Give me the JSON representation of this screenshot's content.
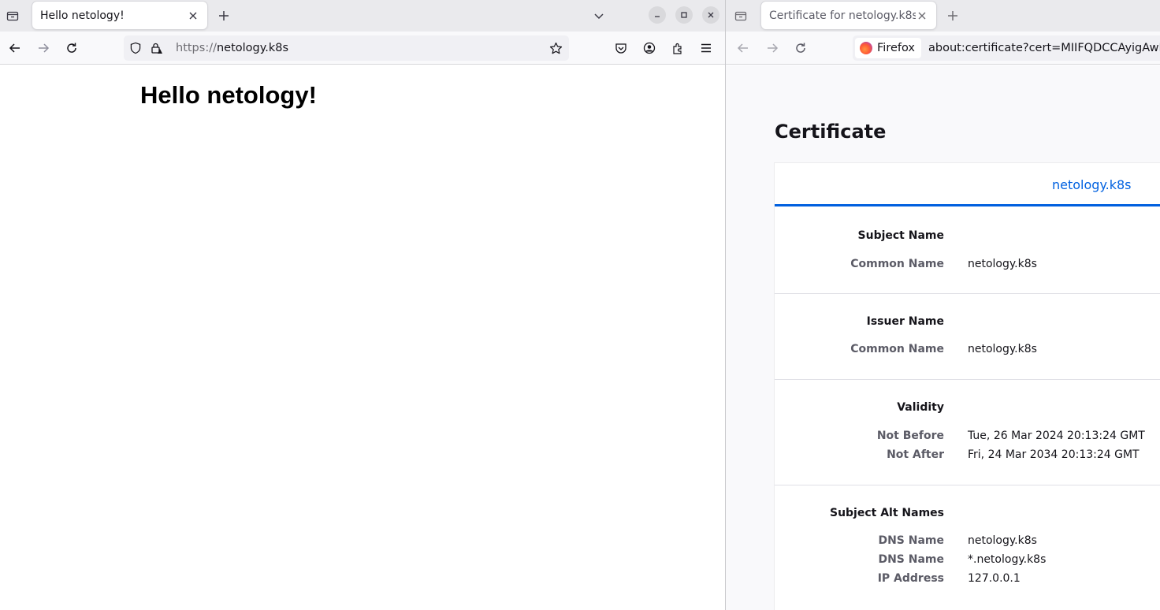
{
  "left_window": {
    "tab_title": "Hello netology!",
    "url_scheme": "https://",
    "url_host": "netology.k8s",
    "page_heading": "Hello netology!"
  },
  "right_window": {
    "tab_title": "Certificate for netology.k8s",
    "identity_label": "Firefox",
    "url": "about:certificate?cert=MIIFQDCCAyigAwIB",
    "page_title": "Certificate",
    "cert_tab": "netology.k8s",
    "sections": {
      "subject": {
        "title": "Subject Name",
        "rows": [
          {
            "label": "Common Name",
            "value": "netology.k8s"
          }
        ]
      },
      "issuer": {
        "title": "Issuer Name",
        "rows": [
          {
            "label": "Common Name",
            "value": "netology.k8s"
          }
        ]
      },
      "validity": {
        "title": "Validity",
        "rows": [
          {
            "label": "Not Before",
            "value": "Tue, 26 Mar 2024 20:13:24 GMT"
          },
          {
            "label": "Not After",
            "value": "Fri, 24 Mar 2034 20:13:24 GMT"
          }
        ]
      },
      "san": {
        "title": "Subject Alt Names",
        "rows": [
          {
            "label": "DNS Name",
            "value": "netology.k8s"
          },
          {
            "label": "DNS Name",
            "value": "*.netology.k8s"
          },
          {
            "label": "IP Address",
            "value": "127.0.0.1"
          }
        ]
      }
    }
  },
  "icons": [
    "tab-list-icon",
    "close-icon",
    "new-tab-icon",
    "chevron-down-icon",
    "minimize-icon",
    "maximize-icon",
    "back-icon",
    "forward-icon",
    "reload-icon",
    "shield-icon",
    "lock-warning-icon",
    "star-icon",
    "pocket-icon",
    "account-icon",
    "extensions-icon",
    "menu-icon",
    "firefox-logo-icon"
  ],
  "colors": {
    "link_blue": "#0061e0",
    "tab_strip": "#eaeaed",
    "window_control": "#d9d9dc"
  }
}
